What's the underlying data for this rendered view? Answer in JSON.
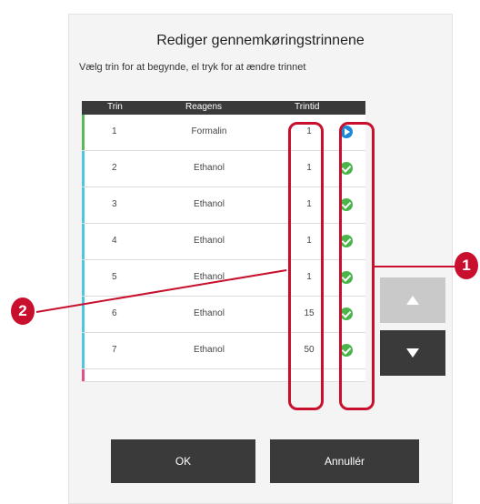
{
  "dialog": {
    "title": "Rediger gennemkøringstrinnene",
    "subtitle": "Vælg trin for at begynde, el tryk for at ændre trinnet"
  },
  "table": {
    "headers": {
      "step": "Trin",
      "reagent": "Reagens",
      "time": "Trintid"
    },
    "rows": [
      {
        "step": "1",
        "reagent": "Formalin",
        "time": "1",
        "status": "play-icon",
        "bar_color": "#5cb85c"
      },
      {
        "step": "2",
        "reagent": "Ethanol",
        "time": "1",
        "status": "check-icon",
        "bar_color": "#4fc6dc"
      },
      {
        "step": "3",
        "reagent": "Ethanol",
        "time": "1",
        "status": "check-icon",
        "bar_color": "#4fc6dc"
      },
      {
        "step": "4",
        "reagent": "Ethanol",
        "time": "1",
        "status": "check-icon",
        "bar_color": "#4fc6dc"
      },
      {
        "step": "5",
        "reagent": "Ethanol",
        "time": "1",
        "status": "check-icon",
        "bar_color": "#4fc6dc"
      },
      {
        "step": "6",
        "reagent": "Ethanol",
        "time": "15",
        "status": "check-icon",
        "bar_color": "#4fc6dc"
      },
      {
        "step": "7",
        "reagent": "Ethanol",
        "time": "50",
        "status": "check-icon",
        "bar_color": "#4fc6dc"
      }
    ],
    "partial_row_bar_color": "#e0508f"
  },
  "scroll": {
    "up_icon": "arrow-up-icon",
    "down_icon": "arrow-down-icon"
  },
  "buttons": {
    "ok": "OK",
    "cancel": "Annullér"
  },
  "callouts": {
    "status_marker": "1",
    "time_marker": "2",
    "color": "#c8102e"
  }
}
